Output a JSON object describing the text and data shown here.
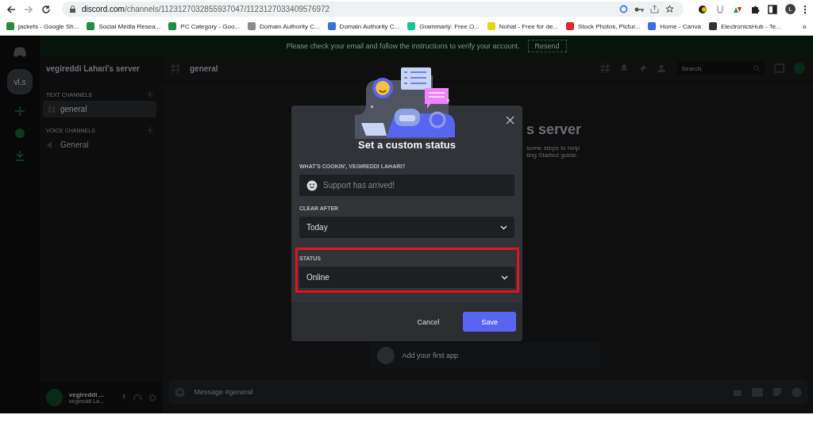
{
  "browser": {
    "url_host": "discord.com",
    "url_path": "/channels/1123127032855937047/1123127033409576972",
    "profile_initial": "L",
    "bookmarks": [
      {
        "label": "jackets - Google Sh...",
        "color": "#1e8e3e"
      },
      {
        "label": "Social Media Resea...",
        "color": "#1e8e3e"
      },
      {
        "label": "PC Category - Goo...",
        "color": "#1e8e3e"
      },
      {
        "label": "Domain Authority C...",
        "color": "#8a8a8a"
      },
      {
        "label": "Domain Authority C...",
        "color": "#3b6fd8"
      },
      {
        "label": "Grammarly: Free O...",
        "color": "#15c39a"
      },
      {
        "label": "Nohat - Free for de...",
        "color": "#e8d21a"
      },
      {
        "label": "Stock Photos, Pictur...",
        "color": "#e0252b"
      },
      {
        "label": "Home - Canva",
        "color": "#3a6be0"
      },
      {
        "label": "ElectronicsHub - Te...",
        "color": "#333333"
      }
    ],
    "more": "»"
  },
  "banner": {
    "text": "Please check your email and follow the instructions to verify your account.",
    "button": "Resend"
  },
  "servers": [
    {
      "label": "vl.s",
      "selected": true
    }
  ],
  "server_name": "vegireddi Lahari's server",
  "channel_groups": [
    {
      "name": "TEXT CHANNELS",
      "kind": "text",
      "channels": [
        {
          "name": "general",
          "selected": true
        }
      ]
    },
    {
      "name": "VOICE CHANNELS",
      "kind": "voice",
      "channels": [
        {
          "name": "General",
          "selected": false
        }
      ]
    }
  ],
  "user": {
    "name": "vegireddi ...",
    "tag": "vegireddi La..."
  },
  "channel_header": {
    "name": "general",
    "search_placeholder": "Search"
  },
  "welcome": {
    "heading": "s server",
    "lines": [
      "some steps to help",
      "ting Started guide."
    ]
  },
  "app_row": "Add your first app",
  "composer_placeholder": "Message #general",
  "modal": {
    "title": "Set a custom status",
    "fields": [
      {
        "kind": "text",
        "label": "WHAT'S COOKIN', VEGIREDDI LAHARI?",
        "placeholder": "Support has arrived!",
        "highlighted": false
      },
      {
        "kind": "select",
        "label": "CLEAR AFTER",
        "value": "Today",
        "highlighted": false
      },
      {
        "kind": "select",
        "label": "STATUS",
        "value": "Online",
        "highlighted": true
      }
    ],
    "buttons": [
      {
        "label": "Cancel",
        "kind": "secondary"
      },
      {
        "label": "Save",
        "kind": "primary"
      }
    ]
  }
}
